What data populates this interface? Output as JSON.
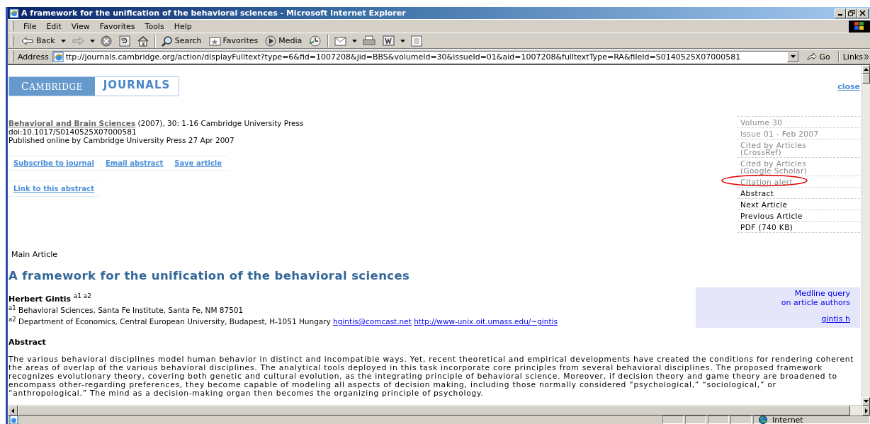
{
  "window": {
    "title": "A framework for the unification of the behavioral sciences - Microsoft Internet Explorer"
  },
  "menu": [
    "File",
    "Edit",
    "View",
    "Favorites",
    "Tools",
    "Help"
  ],
  "toolbar": [
    {
      "kind": "back",
      "label": "Back"
    },
    {
      "kind": "dropdown"
    },
    {
      "kind": "forward"
    },
    {
      "kind": "dropdown"
    },
    {
      "kind": "stop"
    },
    {
      "kind": "refresh"
    },
    {
      "kind": "home"
    },
    {
      "kind": "separator"
    },
    {
      "kind": "search",
      "label": "Search"
    },
    {
      "kind": "favorites",
      "label": "Favorites"
    },
    {
      "kind": "media",
      "label": "Media"
    },
    {
      "kind": "history"
    },
    {
      "kind": "separator"
    },
    {
      "kind": "mail"
    },
    {
      "kind": "dropdown"
    },
    {
      "kind": "print"
    },
    {
      "kind": "word"
    },
    {
      "kind": "dropdown"
    },
    {
      "kind": "discuss"
    }
  ],
  "address": {
    "label": "Address",
    "value": "ttp://journals.cambridge.org/action/displayFulltext?type=6&fid=1007208&jid=BBS&volumeId=30&issueId=01&aid=1007208&fulltextType=RA&fileId=S0140525X07000581",
    "go": "Go",
    "links": "Links"
  },
  "page": {
    "logo": {
      "left": "CAMBRIDGE",
      "right": "JOURNALS"
    },
    "close": "close",
    "citation": {
      "journal": "Behavioral and Brain Sciences",
      "rest": "(2007), 30: 1-16 Cambridge University Press",
      "doi": "doi:10.1017/S0140525X07000581",
      "published": "Published online by Cambridge University Press 27 Apr 2007"
    },
    "actions": [
      "Subscribe to journal",
      "Email abstract",
      "Save article"
    ],
    "link_abstract": "Link to this abstract",
    "sidebar": [
      {
        "label": "Volume 30",
        "disabled": true,
        "circled": false
      },
      {
        "label": "Issue 01 - Feb 2007",
        "disabled": true,
        "circled": false
      },
      {
        "label": "Cited by Articles (CrossRef)",
        "disabled": true,
        "circled": false
      },
      {
        "label": "Cited by Articles (Google Scholar)",
        "disabled": true,
        "circled": false
      },
      {
        "label": "Citation alert",
        "disabled": true,
        "circled": true
      },
      {
        "label": "Abstract",
        "disabled": false,
        "circled": false
      },
      {
        "label": "Next Article",
        "disabled": false,
        "circled": false
      },
      {
        "label": "Previous Article",
        "disabled": false,
        "circled": false
      },
      {
        "label": "PDF (740 KB)",
        "disabled": false,
        "circled": false
      }
    ],
    "section_label": "Main Article",
    "article_title": "A framework for the unification of the behavioral sciences",
    "author": "**Herbert Gintis** $^{a1 a2}$",
    "affiliations": [
      {
        "text": "$^{a1}$ Behavioral Sciences, Santa Fe Institute, Santa Fe, NM 87501"
      },
      {
        "text": "$^{a2}$ Department of Economics, Central European University, Budapest, H-1051 Hungary",
        "links": [
          "hgintis@comcast.net",
          "http://www-unix.oit.umass.edu/~gintis"
        ]
      }
    ],
    "medline": {
      "lines": [
        "Medline query",
        "on article authors"
      ],
      "author_link": "gintis h"
    },
    "abstract_heading": "Abstract",
    "abstract": "The various behavioral disciplines model human behavior in distinct and incompatible ways. Yet, recent theoretical and empirical developments have created the conditions for rendering coherent the areas of overlap of the various behavioral disciplines. The analytical tools deployed in this task incorporate core principles from several behavioral disciplines. The proposed framework recognizes evolutionary theory, covering both genetic and cultural evolution, as the integrating principle of behavioral science. Moreover, if decision theory and game theory are broadened to encompass other-regarding preferences, they become capable of modeling all aspects of decision making, including those normally considered “psychological,” “sociological,” or “anthropological.” The mind as a decision-making organ then becomes the organizing principle of psychology."
  },
  "status_bar": {
    "zone": "Internet"
  }
}
